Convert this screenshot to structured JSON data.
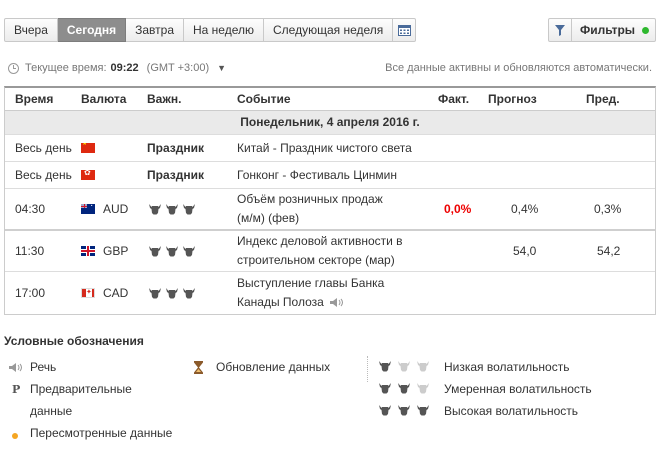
{
  "tabs": [
    "Вчера",
    "Сегодня",
    "Завтра",
    "На неделю",
    "Следующая неделя"
  ],
  "active_tab": "Сегодня",
  "filters_label": "Фильтры",
  "time_bar": {
    "label": "Текущее время:",
    "time": "09:22",
    "timezone": "(GMT +3:00)",
    "auto_update": "Все данные активны и обновляются автоматически."
  },
  "columns": {
    "time": "Время",
    "currency": "Валюта",
    "importance": "Важн.",
    "event": "Событие",
    "actual": "Факт.",
    "forecast": "Прогноз",
    "previous": "Пред."
  },
  "date_header": "Понедельник, 4 апреля 2016 г.",
  "holidays": [
    {
      "time": "Весь день",
      "flag": "cn",
      "importance": "Праздник",
      "event": "Китай - Праздник чистого света"
    },
    {
      "time": "Весь день",
      "flag": "hk",
      "importance": "Праздник",
      "event": "Гонконг - Фестиваль Цинмин"
    }
  ],
  "events": [
    {
      "time": "04:30",
      "flag": "au",
      "currency": "AUD",
      "bulls": 3,
      "event_line1": "Объём розничных продаж",
      "event_line2": "(м/м) (фев)",
      "actual": "0,0%",
      "forecast": "0,4%",
      "previous": "0,3%"
    },
    {
      "time": "11:30",
      "flag": "gb",
      "currency": "GBP",
      "bulls": 3,
      "event_line1": "Индекс деловой активности в",
      "event_line2": "строительном секторе (мар)",
      "actual": "",
      "forecast": "54,0",
      "previous": "54,2"
    },
    {
      "time": "17:00",
      "flag": "ca",
      "currency": "CAD",
      "bulls": 3,
      "event_line1": "Выступление главы Банка",
      "event_line2": "Канады Полоза",
      "actual": "",
      "forecast": "",
      "previous": ""
    }
  ],
  "legend": {
    "title": "Условные обозначения",
    "speech": "Речь",
    "preliminary_line1": "Предварительные",
    "preliminary_line2": "данные",
    "preliminary_symbol": "P",
    "revised": "Пересмотренные данные",
    "update": "Обновление данных",
    "low": "Низкая волатильность",
    "medium": "Умеренная волатильность",
    "high": "Высокая волатильность"
  },
  "colors": {
    "active_tab": "#8d8d8d",
    "actual_negative": "#ee0000",
    "filter_dot": "#2eb82e",
    "bull_dark": "#555555",
    "bull_light": "#cccccc",
    "revised_dot": "#f5a623"
  }
}
